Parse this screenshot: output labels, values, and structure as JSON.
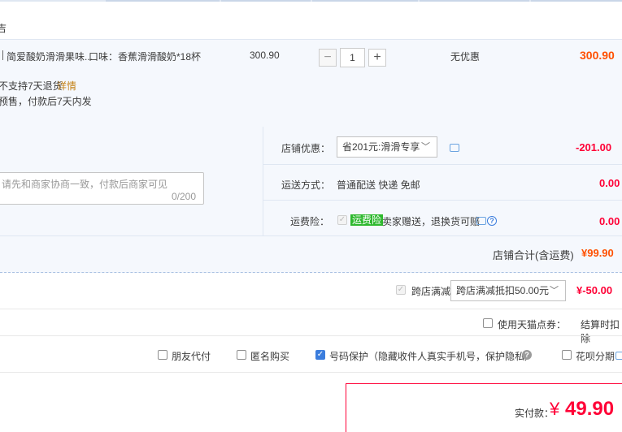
{
  "shop": {
    "label_fragment": "吉"
  },
  "item": {
    "title": "简爱酸奶滑滑果味...",
    "sku": "口味：香蕉滑滑酸奶*18杯",
    "price": "300.90",
    "quantity": "1",
    "discount": "无优惠",
    "subtotal": "300.90",
    "return_note": "不支持7天退货",
    "detail_link": "详情",
    "presale_note": "预售，付款后7天内发"
  },
  "message": {
    "placeholder": "请先和商家协商一致，付款后商家可见",
    "counter": "0/200"
  },
  "shop_discount": {
    "label": "店铺优惠：",
    "selected": "省201元:滑滑专享",
    "amount": "-201.00"
  },
  "shipping": {
    "label": "运送方式：",
    "value": "普通配送 快递 免邮",
    "amount": "0.00"
  },
  "insurance": {
    "label": "运费险：",
    "badge": "运费险",
    "text": "卖家赠送，退换货可赔",
    "amount": "0.00"
  },
  "shop_total": {
    "label": "店铺合计(含运费)",
    "amount": "¥99.90"
  },
  "cross_store": {
    "label": "跨店满减",
    "selected": "跨店满减抵扣50.00元",
    "amount": "¥-50.00"
  },
  "tmall_points": {
    "label": "使用天猫点券：",
    "note": "结算时扣除"
  },
  "options": {
    "friend_pay": "朋友代付",
    "anonymous": "匿名购买",
    "number_protect": "号码保护（隐藏收件人真实手机号，保护隐私）",
    "huabei": "花呗分期"
  },
  "payment": {
    "label": "实付款：",
    "currency": "¥",
    "amount": "49.90"
  },
  "colors": {
    "accent_red": "#ff0036",
    "price_orange": "#ff5000",
    "panel_bg": "#f5f8fd",
    "checkbox_blue": "#3b7ddd"
  }
}
